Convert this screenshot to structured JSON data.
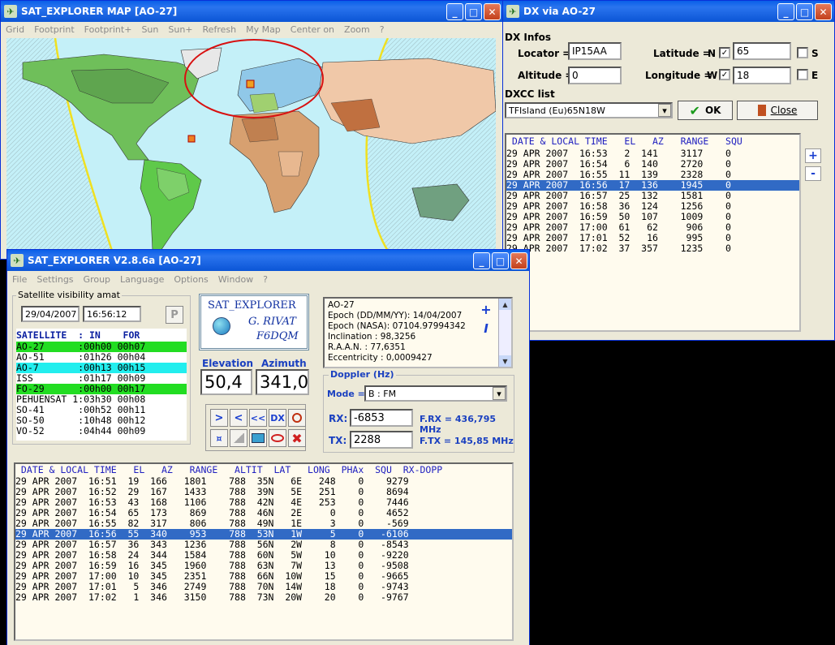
{
  "map_window": {
    "title": "SAT_EXPLORER MAP [AO-27]",
    "menu": [
      "Grid",
      "Footprint",
      "Footprint+",
      "Sun",
      "Sun+",
      "Refresh",
      "My Map",
      "Center on",
      "Zoom",
      "?"
    ]
  },
  "dx_window": {
    "title": "DX via AO-27",
    "group_label": "DX Infos",
    "locator_label": "Locator =",
    "locator_value": "IP15AA",
    "altitude_label": "Altitude =",
    "altitude_value": "0",
    "latitude_label": "Latitude =",
    "latitude_hemi": "N",
    "latitude_value": "65",
    "longitude_label": "Longitude =",
    "longitude_hemi": "W",
    "longitude_value": "18",
    "s_label": "S",
    "e_label": "E",
    "check_mark": "✓",
    "dxcc_label": "DXCC list",
    "dxcc_value": "TFIsland (Eu)65N18W",
    "ok_label": "OK",
    "close_label": "Close",
    "table_header": " DATE & LOCAL TIME   EL   AZ   RANGE   SQU",
    "rows": [
      "29 APR 2007  16:53   2  141    3117    0",
      "29 APR 2007  16:54   6  140    2720    0",
      "29 APR 2007  16:55  11  139    2328    0",
      "29 APR 2007  16:56  17  136    1945    0",
      "29 APR 2007  16:57  25  132    1581    0",
      "29 APR 2007  16:58  36  124    1256    0",
      "29 APR 2007  16:59  50  107    1009    0",
      "29 APR 2007  17:00  61   62     906    0",
      "29 APR 2007  17:01  52   16     995    0",
      "29 APR 2007  17:02  37  357    1235    0"
    ],
    "selected_row": 3,
    "plus": "+",
    "minus": "-"
  },
  "main_window": {
    "title": "SAT_EXPLORER V2.8.6a [AO-27]",
    "menu": [
      "File",
      "Settings",
      "Group",
      "Language",
      "Options",
      "Window",
      "?"
    ],
    "visibility_label": "Satellite visibility  amat",
    "date_value": "29/04/2007",
    "time_value": "16:56:12",
    "p_button": "P",
    "sat_header": "SATELLITE  : IN    FOR",
    "satellites": [
      {
        "text": "AO-27      :00h00 00h07",
        "color": "#22dd22"
      },
      {
        "text": "AO-51      :01h26 00h04",
        "color": ""
      },
      {
        "text": "AO-7       :00h13 00h15",
        "color": "#22eeee"
      },
      {
        "text": "ISS        :01h17 00h09",
        "color": ""
      },
      {
        "text": "FO-29      :00h00 00h17",
        "color": "#22dd22"
      },
      {
        "text": "PEHUENSAT 1:03h30 00h08",
        "color": ""
      },
      {
        "text": "SO-41      :00h52 00h11",
        "color": ""
      },
      {
        "text": "SO-50      :10h48 00h12",
        "color": ""
      },
      {
        "text": "VO-52      :04h44 00h09",
        "color": ""
      }
    ],
    "logo_line1": "SAT_EXPLORER",
    "logo_line2": "G. RIVAT",
    "logo_line3": "F6DQM",
    "elevation_label": "Elevation",
    "azimuth_label": "Azimuth",
    "elevation_value": "50,4",
    "azimuth_value": "341,0",
    "buttons": {
      "next": ">",
      "prev": "<",
      "rewind": "<<",
      "dx": "DX",
      "stop": "✖"
    },
    "info_lines": [
      "AO-27",
      "Epoch (DD/MM/YY): 14/04/2007",
      "Epoch (NASA): 07104.97994342",
      "Inclination : 98,3256",
      "R.A.A.N. : 77,6351",
      "Eccentricity : 0,0009427"
    ],
    "info_plus": "+",
    "info_i": "I",
    "doppler_label": "Doppler (Hz)",
    "mode_label": "Mode =",
    "mode_value": "B : FM",
    "rx_label": "RX:",
    "rx_value": "-6853",
    "frx_label": "F.RX = 436,795 MHz",
    "tx_label": "TX:",
    "tx_value": "2288",
    "ftx_label": "F.TX = 145,85 MHz",
    "table_header": " DATE & LOCAL TIME   EL   AZ   RANGE   ALTIT  LAT   LONG  PHAx  SQU  RX-DOPP",
    "rows": [
      "29 APR 2007  16:51  19  166   1801    788  35N   6E   248    0    9279",
      "29 APR 2007  16:52  29  167   1433    788  39N   5E   251    0    8694",
      "29 APR 2007  16:53  43  168   1106    788  42N   4E   253    0    7446",
      "29 APR 2007  16:54  65  173    869    788  46N   2E     0    0    4652",
      "29 APR 2007  16:55  82  317    806    788  49N   1E     3    0    -569",
      "29 APR 2007  16:56  55  340    953    788  53N   1W     5    0   -6106",
      "29 APR 2007  16:57  36  343   1236    788  56N   2W     8    0   -8543",
      "29 APR 2007  16:58  24  344   1584    788  60N   5W    10    0   -9220",
      "29 APR 2007  16:59  16  345   1960    788  63N   7W    13    0   -9508",
      "29 APR 2007  17:00  10  345   2351    788  66N  10W    15    0   -9665",
      "29 APR 2007  17:01   5  346   2749    788  70N  14W    18    0   -9743",
      "29 APR 2007  17:02   1  346   3150    788  73N  20W    20    0   -9767"
    ],
    "selected_row": 5
  },
  "icons": {
    "minimize": "_",
    "maximize": "□",
    "close": "✕",
    "app": "✈",
    "combo_arrow": "▾",
    "up": "▲",
    "down": "▼"
  },
  "colors": {
    "titlebar": "#0a5fe8",
    "selection": "#316ac5",
    "list_bg": "#fffbee",
    "header_text": "#2020c0",
    "ocean": "#c4f0f8"
  }
}
